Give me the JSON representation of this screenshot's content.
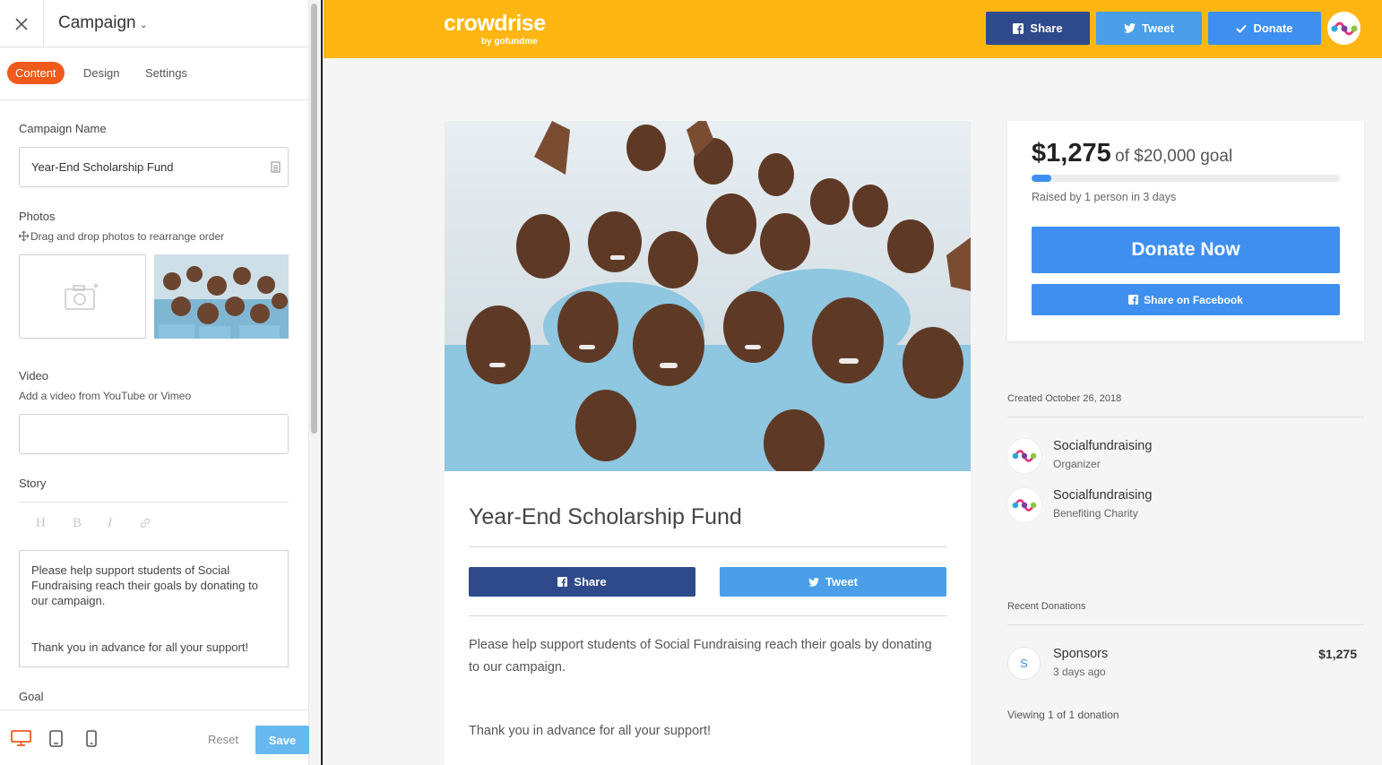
{
  "editor": {
    "title": "Campaign",
    "tabs": [
      {
        "label": "Content"
      },
      {
        "label": "Design"
      },
      {
        "label": "Settings"
      }
    ],
    "campaign_name_label": "Campaign Name",
    "campaign_name_value": "Year-End Scholarship Fund",
    "photos_label": "Photos",
    "photos_hint": "Drag and drop photos to rearrange order",
    "video_label": "Video",
    "video_hint": "Add a video from YouTube or Vimeo",
    "video_value": "",
    "story_label": "Story",
    "format_buttons": [
      "H",
      "B",
      "I"
    ],
    "story_para1": "Please help support students of Social Fundraising reach their goals by donating to our campaign.",
    "story_para2": "Thank you in advance for all your support!",
    "goal_label": "Goal",
    "reset_label": "Reset",
    "save_label": "Save"
  },
  "preview": {
    "logo": {
      "main": "crowdrise",
      "by": "by gofundme"
    },
    "topbar": {
      "share": "Share",
      "tweet": "Tweet",
      "donate": "Donate"
    },
    "campaign_title": "Year-End Scholarship Fund",
    "share_label": "Share",
    "tweet_label": "Tweet",
    "description_para1": "Please help support students of Social Fundraising reach their goals by donating to our campaign.",
    "description_para2": "Thank you in advance for all your support!",
    "raised_amount": "$1,275",
    "goal_text": "of $20,000 goal",
    "progress_fraction": 0.064,
    "raised_by": "Raised by 1 person in 3 days",
    "donate_now": "Donate Now",
    "share_facebook": "Share on Facebook",
    "created": "Created October 26, 2018",
    "organizers": [
      {
        "name": "Socialfundraising",
        "role": "Organizer"
      },
      {
        "name": "Socialfundraising",
        "role": "Benefiting Charity"
      }
    ],
    "recent_donations_label": "Recent Donations",
    "donations": [
      {
        "initial": "S",
        "name": "Sponsors",
        "time": "3 days ago",
        "amount": "$1,275"
      }
    ],
    "viewing_text": "Viewing 1 of 1 donation"
  },
  "colors": {
    "accent_orange": "#ef5a1d",
    "topbar_yellow": "#ffb612",
    "facebook_blue": "#2e4a8a",
    "twitter_blue": "#4a9fe8",
    "donate_blue": "#3e8ff0",
    "save_blue": "#67b8ef"
  },
  "icons": [
    "close-icon",
    "chevron-down-icon",
    "note-icon",
    "move-icon",
    "camera-add-icon",
    "link-icon",
    "desktop-icon",
    "tablet-icon",
    "mobile-icon",
    "facebook-icon",
    "twitter-icon",
    "checkmark-icon",
    "social-logo-icon"
  ]
}
